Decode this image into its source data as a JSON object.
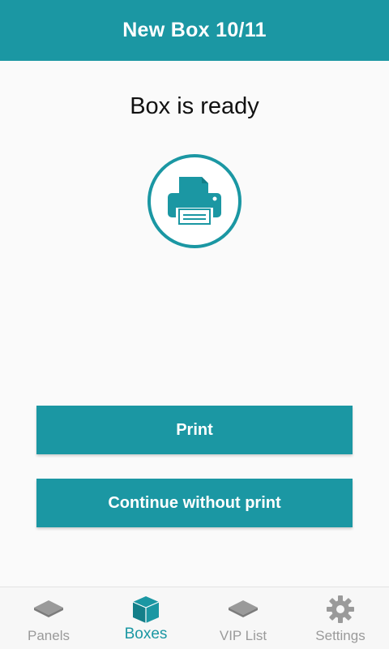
{
  "header": {
    "title": "New Box 10/11"
  },
  "main": {
    "status": "Box is ready",
    "icon": "printer-icon",
    "print_label": "Print",
    "continue_label": "Continue without print"
  },
  "bottom_nav": {
    "items": [
      {
        "label": "Panels",
        "icon": "panels-icon",
        "active": false
      },
      {
        "label": "Boxes",
        "icon": "box-icon",
        "active": true
      },
      {
        "label": "VIP List",
        "icon": "vip-list-icon",
        "active": false
      },
      {
        "label": "Settings",
        "icon": "gear-icon",
        "active": false
      }
    ]
  },
  "colors": {
    "accent": "#1b97a3",
    "inactive": "#9a9a9a",
    "background": "#fafafa"
  }
}
